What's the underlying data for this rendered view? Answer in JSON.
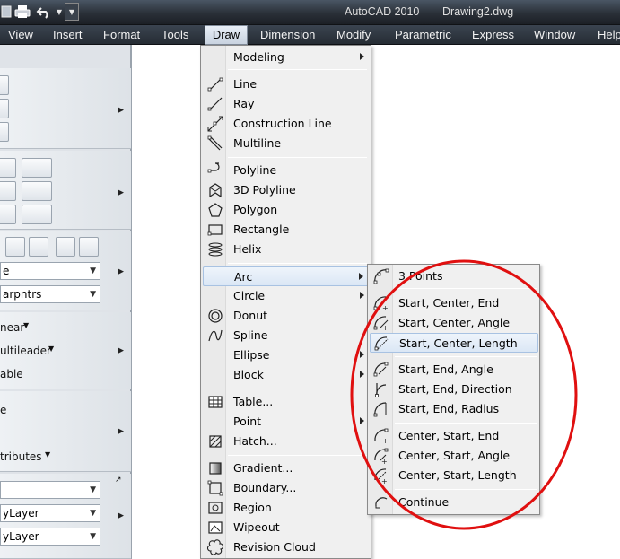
{
  "window": {
    "app_title": "AutoCAD 2010",
    "document_title": "Drawing2.dwg"
  },
  "menubar": {
    "items": [
      "View",
      "Insert",
      "Format",
      "Tools",
      "Draw",
      "Dimension",
      "Modify",
      "Parametric",
      "Express",
      "Window",
      "Help"
    ],
    "active": "Draw"
  },
  "ribbon": {
    "dim_linear": "near",
    "multileader": "ultileader",
    "table": "able",
    "text_e": "e",
    "attributes": "tributes",
    "combo_style": "e",
    "combo_layer": "arpntrs",
    "combo_bylayer_1": "",
    "combo_bylayer_2": "yLayer",
    "combo_bylayer_3": "yLayer"
  },
  "draw_menu": {
    "items": [
      {
        "label": "Modeling",
        "icon": "none",
        "submenu": true
      },
      {
        "label": "Line",
        "icon": "line-icon"
      },
      {
        "label": "Ray",
        "icon": "ray-icon"
      },
      {
        "label": "Construction Line",
        "icon": "construction-line-icon"
      },
      {
        "label": "Multiline",
        "icon": "multiline-icon"
      },
      {
        "label": "Polyline",
        "icon": "polyline-icon"
      },
      {
        "label": "3D Polyline",
        "icon": "3d-polyline-icon"
      },
      {
        "label": "Polygon",
        "icon": "polygon-icon"
      },
      {
        "label": "Rectangle",
        "icon": "rectangle-icon"
      },
      {
        "label": "Helix",
        "icon": "helix-icon"
      },
      {
        "label": "Arc",
        "icon": "none",
        "submenu": true
      },
      {
        "label": "Circle",
        "icon": "none",
        "submenu": true
      },
      {
        "label": "Donut",
        "icon": "donut-icon"
      },
      {
        "label": "Spline",
        "icon": "spline-icon"
      },
      {
        "label": "Ellipse",
        "icon": "none",
        "submenu": true
      },
      {
        "label": "Block",
        "icon": "none",
        "submenu": true
      },
      {
        "label": "Table...",
        "icon": "table-icon"
      },
      {
        "label": "Point",
        "icon": "none",
        "submenu": true
      },
      {
        "label": "Hatch...",
        "icon": "hatch-icon"
      },
      {
        "label": "Gradient...",
        "icon": "gradient-icon"
      },
      {
        "label": "Boundary...",
        "icon": "boundary-icon"
      },
      {
        "label": "Region",
        "icon": "region-icon"
      },
      {
        "label": "Wipeout",
        "icon": "wipeout-icon"
      },
      {
        "label": "Revision Cloud",
        "icon": "revision-cloud-icon"
      }
    ],
    "highlighted": "Arc"
  },
  "arc_menu": {
    "items": [
      {
        "label": "3 Points",
        "icon": "arc-3points-icon"
      },
      {
        "label": "Start, Center, End",
        "icon": "arc-sce-icon"
      },
      {
        "label": "Start, Center, Angle",
        "icon": "arc-sca-icon"
      },
      {
        "label": "Start, Center, Length",
        "icon": "arc-scl-icon"
      },
      {
        "label": "Start, End, Angle",
        "icon": "arc-sea-icon"
      },
      {
        "label": "Start, End, Direction",
        "icon": "arc-sed-icon"
      },
      {
        "label": "Start, End, Radius",
        "icon": "arc-ser-icon"
      },
      {
        "label": "Center, Start, End",
        "icon": "arc-cse-icon"
      },
      {
        "label": "Center, Start, Angle",
        "icon": "arc-csa-icon"
      },
      {
        "label": "Center, Start, Length",
        "icon": "arc-csl-icon"
      },
      {
        "label": "Continue",
        "icon": "arc-continue-icon"
      }
    ],
    "highlighted": "Start, Center, Length"
  },
  "colors": {
    "annotation": "#e01010",
    "menubar_bg": "#2e3540",
    "highlight": "#dbe7f5"
  }
}
